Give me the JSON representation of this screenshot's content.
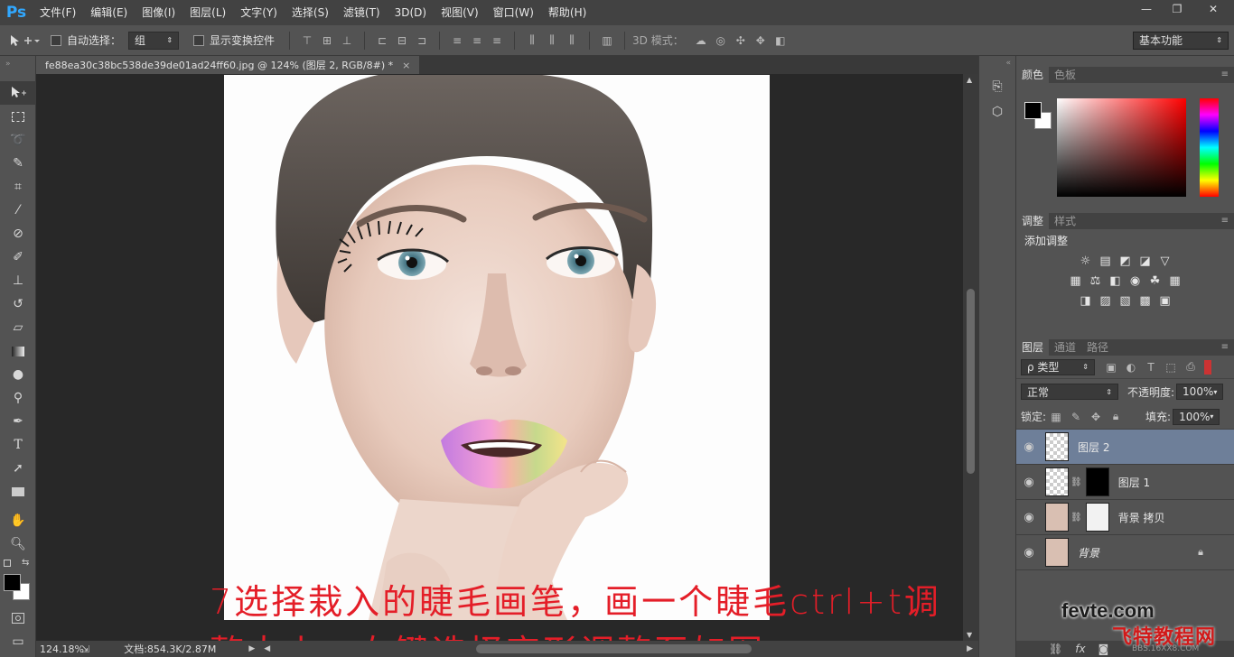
{
  "app": {
    "logo": "Ps"
  },
  "menu": [
    "文件(F)",
    "编辑(E)",
    "图像(I)",
    "图层(L)",
    "文字(Y)",
    "选择(S)",
    "滤镜(T)",
    "3D(D)",
    "视图(V)",
    "窗口(W)",
    "帮助(H)"
  ],
  "window_controls": {
    "minimize": "—",
    "restore": "❐",
    "close": "✕"
  },
  "options": {
    "auto_select_label": "自动选择：",
    "auto_select_value": "组",
    "show_transform_label": "显示变换控件",
    "mode3d_label": "3D 模式：",
    "workspace": "基本功能"
  },
  "document": {
    "tab_title": "fe88ea30c38bc538de39de01ad24ff60.jpg @ 124% (图层 2, RGB/8#) *",
    "close": "×",
    "zoom": "124.18%",
    "doc_info": "文档:854.3K/2.87M"
  },
  "color_panel": {
    "tabs": [
      "颜色",
      "色板"
    ],
    "active_tab": "颜色",
    "foreground": "#000000",
    "background": "#ffffff",
    "picked_hue": "#ff0000"
  },
  "adjust_panel": {
    "tabs": [
      "调整",
      "样式"
    ],
    "title": "添加调整",
    "icons_row1": [
      "brightness-icon",
      "levels-icon",
      "curves-icon",
      "exposure-icon",
      "vibrance-icon"
    ],
    "icons_row2": [
      "hue-saturation-icon",
      "color-balance-icon",
      "black-white-icon",
      "photo-filter-icon",
      "channel-mixer-icon",
      "color-lookup-icon"
    ],
    "icons_row3": [
      "invert-icon",
      "posterize-icon",
      "threshold-icon",
      "gradient-map-icon",
      "selective-color-icon"
    ]
  },
  "layers_panel": {
    "tabs": [
      "图层",
      "通道",
      "路径"
    ],
    "filter": "ρ 类型",
    "blend_mode": "正常",
    "opacity_label": "不透明度:",
    "opacity": "100%",
    "lock_label": "锁定:",
    "fill_label": "填充:",
    "fill": "100%",
    "layers": [
      {
        "name": "图层 2",
        "selected": true
      },
      {
        "name": "图层 1",
        "selected": false
      },
      {
        "name": "背景 拷贝",
        "selected": false
      },
      {
        "name": "背景",
        "selected": false,
        "locked": true
      }
    ],
    "footer_icons": [
      "link-icon",
      "fx-icon",
      "mask-icon"
    ]
  },
  "annotation": {
    "line1": "7选择栽入的睫毛画笔，画一个睫毛ctrl+t调",
    "line2": "整大小，右键选择变形调整至如图。"
  },
  "watermark": {
    "site": "fevte.com",
    "name": "飞特教程网",
    "sub": "BBS.16XX8.COM"
  },
  "colors": {
    "accent": "#31a8ff",
    "annotation": "#e41e28",
    "selection": "#6e7f99"
  }
}
